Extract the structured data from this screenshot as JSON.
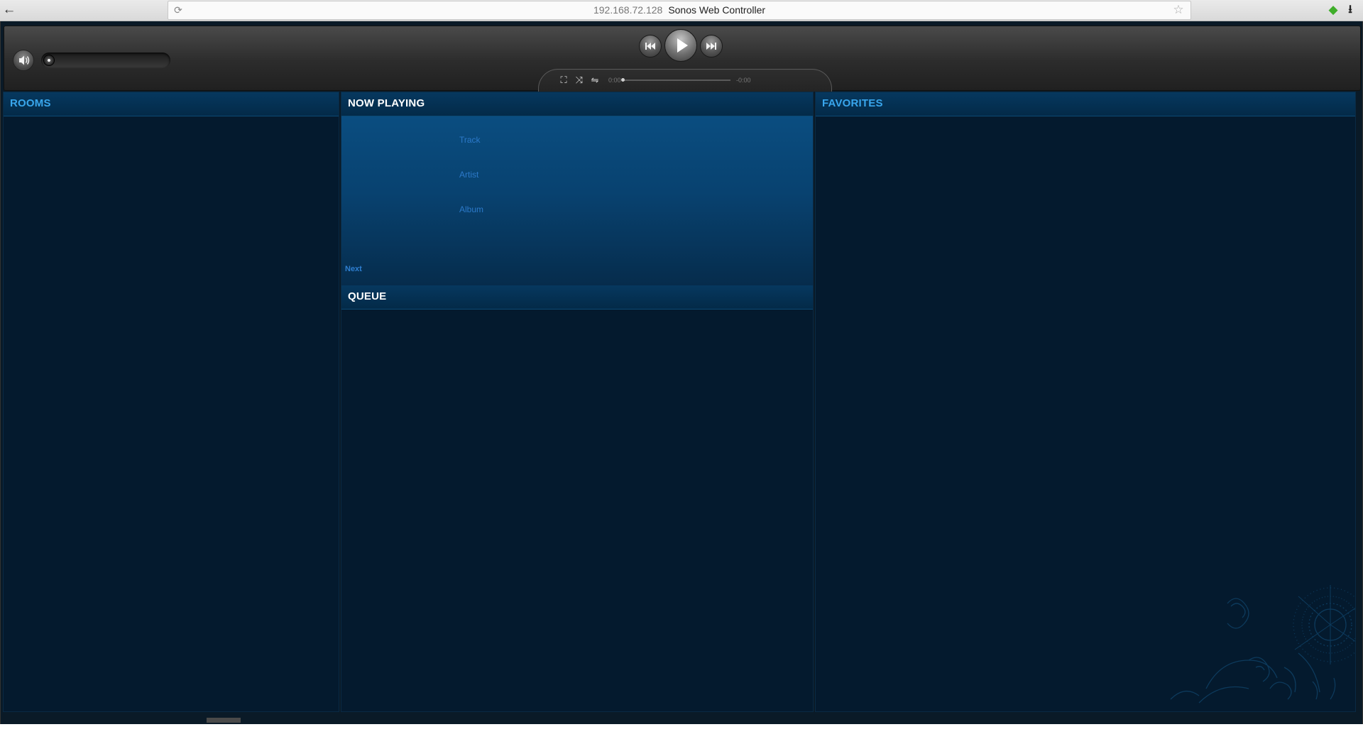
{
  "browser": {
    "back_glyph": "←",
    "reload_glyph": "⟳",
    "url_host": "192.168.72.128",
    "page_title": "Sonos Web Controller",
    "star_glyph": "☆",
    "addon_glyph": "◆",
    "download_glyph": "⭳"
  },
  "player": {
    "volume_level": 0,
    "elapsed": "0:00",
    "remaining": "-0:00",
    "progress": 0,
    "modes": {
      "repeat_glyph": "⛶",
      "shuffle_glyph": "⤨",
      "crossfade_glyph": "⇋"
    }
  },
  "panels": {
    "rooms": {
      "title": "ROOMS"
    },
    "now_playing": {
      "title": "NOW PLAYING",
      "track": "Track",
      "artist": "Artist",
      "album": "Album",
      "next": "Next"
    },
    "queue": {
      "title": "QUEUE"
    },
    "favorites": {
      "title": "FAVORITES"
    }
  },
  "colors": {
    "accent": "#2f8edb",
    "panel_bg": "#041a2e",
    "header_bg": "#06385f"
  }
}
